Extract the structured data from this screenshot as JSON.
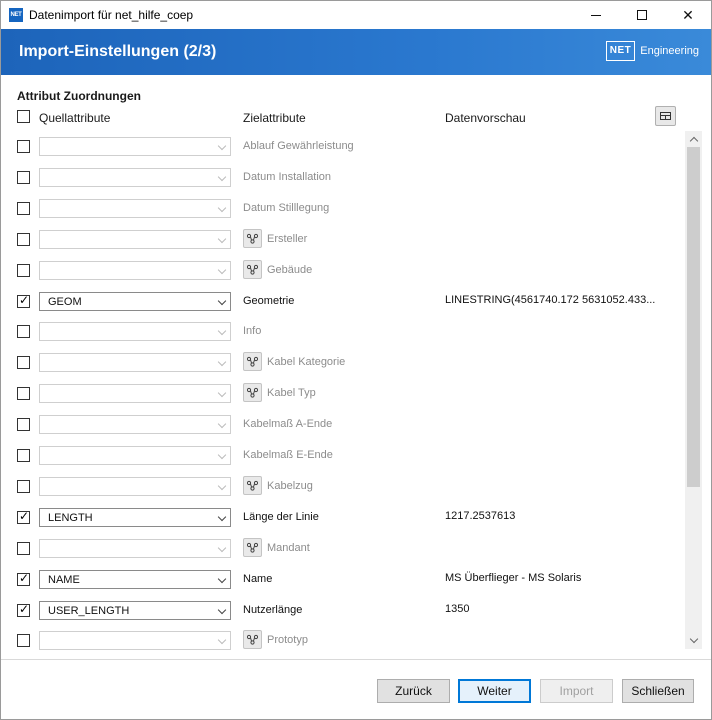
{
  "window": {
    "app_icon": "NET",
    "title": "Datenimport für net_hilfe_coep"
  },
  "header": {
    "title": "Import-Einstellungen (2/3)",
    "brand_logo": "NET",
    "brand_text": "Engineering"
  },
  "section": {
    "title": "Attribut Zuordnungen",
    "columns": {
      "source": "Quellattribute",
      "target": "Zielattribute",
      "preview": "Datenvorschau"
    }
  },
  "rows": [
    {
      "checked": false,
      "source": "",
      "target": "Ablauf Gewährleistung",
      "link": false,
      "preview": ""
    },
    {
      "checked": false,
      "source": "",
      "target": "Datum Installation",
      "link": false,
      "preview": ""
    },
    {
      "checked": false,
      "source": "",
      "target": "Datum Stilllegung",
      "link": false,
      "preview": ""
    },
    {
      "checked": false,
      "source": "",
      "target": "Ersteller",
      "link": true,
      "preview": ""
    },
    {
      "checked": false,
      "source": "",
      "target": "Gebäude",
      "link": true,
      "preview": ""
    },
    {
      "checked": true,
      "source": "GEOM",
      "target": "Geometrie",
      "link": false,
      "preview": "LINESTRING(4561740.172 5631052.433..."
    },
    {
      "checked": false,
      "source": "",
      "target": "Info",
      "link": false,
      "preview": ""
    },
    {
      "checked": false,
      "source": "",
      "target": "Kabel Kategorie",
      "link": true,
      "preview": ""
    },
    {
      "checked": false,
      "source": "",
      "target": "Kabel Typ",
      "link": true,
      "preview": ""
    },
    {
      "checked": false,
      "source": "",
      "target": "Kabelmaß A-Ende",
      "link": false,
      "preview": ""
    },
    {
      "checked": false,
      "source": "",
      "target": "Kabelmaß E-Ende",
      "link": false,
      "preview": ""
    },
    {
      "checked": false,
      "source": "",
      "target": "Kabelzug",
      "link": true,
      "preview": ""
    },
    {
      "checked": true,
      "source": "LENGTH",
      "target": "Länge der Linie",
      "link": false,
      "preview": "1217.2537613"
    },
    {
      "checked": false,
      "source": "",
      "target": "Mandant",
      "link": true,
      "preview": ""
    },
    {
      "checked": true,
      "source": "NAME",
      "target": "Name",
      "link": false,
      "preview": "MS Überflieger - MS Solaris"
    },
    {
      "checked": true,
      "source": "USER_LENGTH",
      "target": "Nutzerlänge",
      "link": false,
      "preview": "1350"
    },
    {
      "checked": false,
      "source": "",
      "target": "Prototyp",
      "link": true,
      "preview": ""
    }
  ],
  "footer": {
    "back": "Zurück",
    "next": "Weiter",
    "import": "Import",
    "close": "Schließen"
  },
  "icons": {
    "link": "hierarchy-link-icon",
    "table": "table-icon",
    "dropdown": "chevron-down-icon"
  },
  "colors": {
    "header_start": "#1d64ba",
    "header_end": "#3a8ad9",
    "default_button_border": "#0078d7"
  }
}
